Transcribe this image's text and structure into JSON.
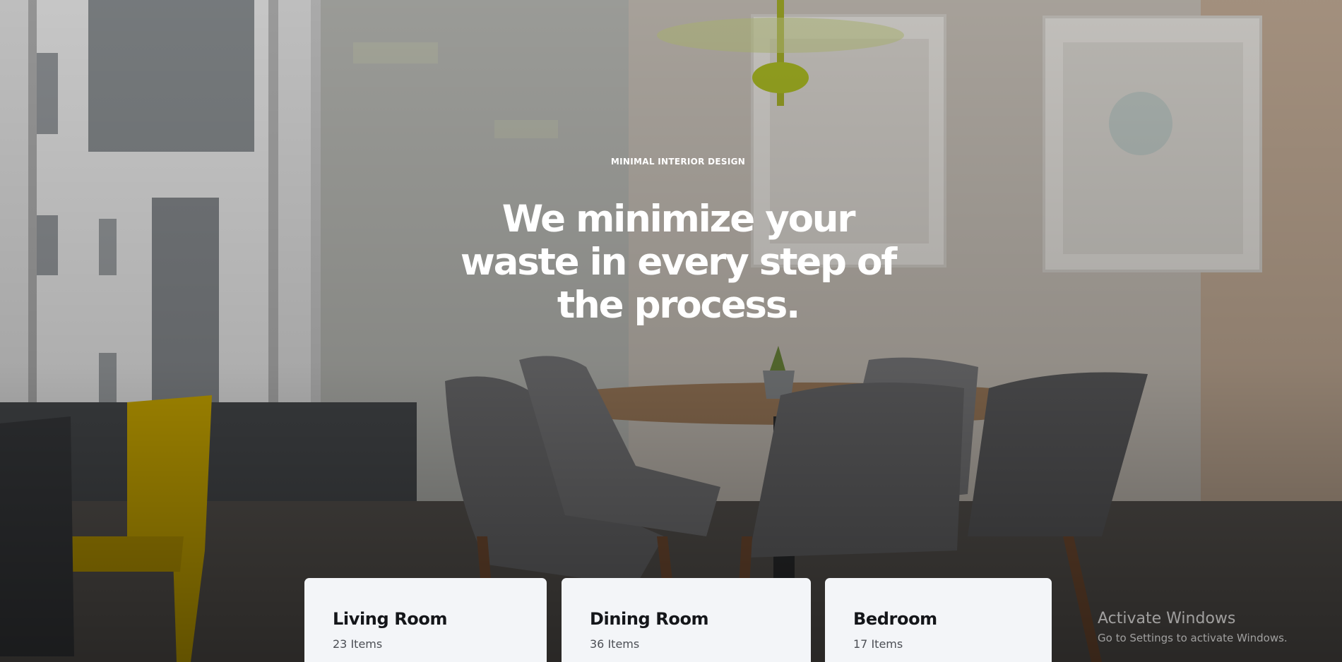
{
  "hero": {
    "eyebrow": "MINIMAL INTERIOR DESIGN",
    "headline_lines": [
      "We minimize your",
      "waste in every step of",
      "the process."
    ]
  },
  "categories": [
    {
      "title": "Living Room",
      "count": "23 Items"
    },
    {
      "title": "Dining Room",
      "count": "36 Items"
    },
    {
      "title": "Bedroom",
      "count": "17 Items"
    }
  ],
  "watermark": {
    "title": "Activate Windows",
    "subtitle": "Go to Settings to activate Windows."
  },
  "colors": {
    "card_background": "#f3f5f8",
    "card_title": "#14161a",
    "headline": "#ffffff",
    "chair_yellow": "#d9b400"
  }
}
